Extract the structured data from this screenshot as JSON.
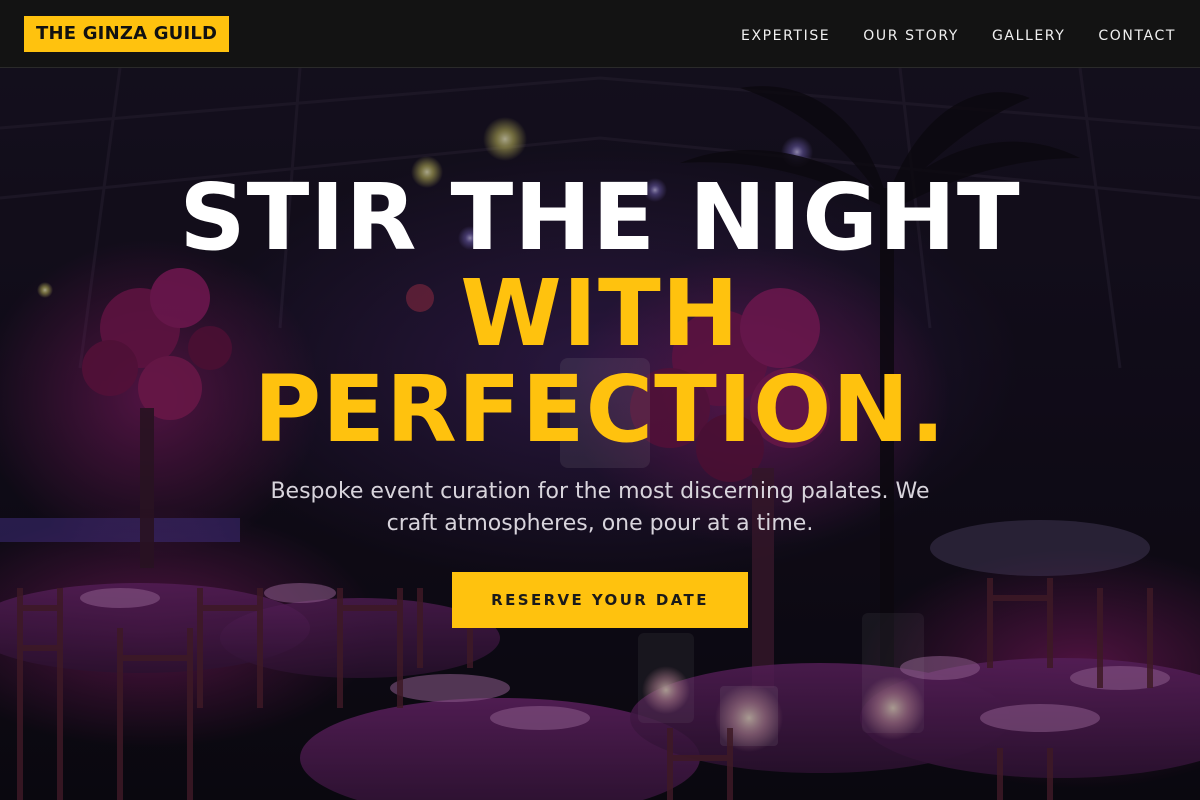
{
  "brand": {
    "logo_text": "THE GINZA GUILD",
    "accent_color": "#ffc20e"
  },
  "nav": {
    "links": [
      {
        "label": "EXPERTISE"
      },
      {
        "label": "OUR STORY"
      },
      {
        "label": "GALLERY"
      },
      {
        "label": "CONTACT"
      }
    ]
  },
  "hero": {
    "headline_line1": "STIR THE NIGHT",
    "headline_line2": "WITH",
    "headline_line3": "PERFECTION.",
    "subtitle": "Bespoke event curation for the most discerning palates. We craft atmospheres, one pour at a time.",
    "cta_label": "RESERVE YOUR DATE",
    "background_image": "dim banquet hall with purple lighting, set round tables and floral centerpieces"
  }
}
